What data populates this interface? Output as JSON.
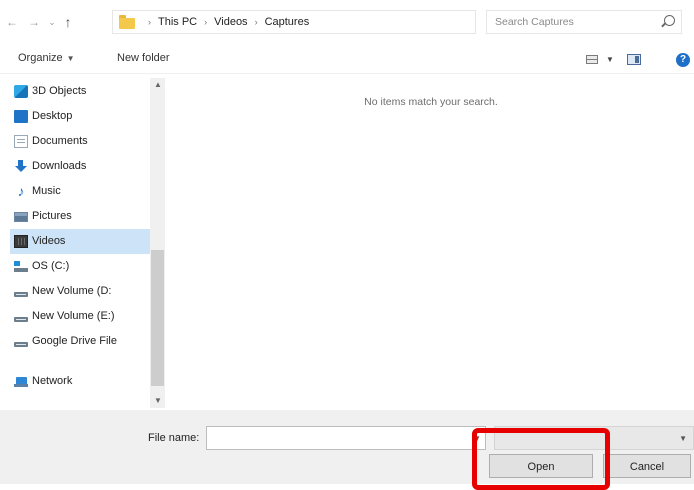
{
  "navigation": {
    "back_icon": "arrow-left-icon",
    "forward_icon": "arrow-right-icon",
    "recent_icon": "chevron-down-icon",
    "up_icon": "arrow-up-icon"
  },
  "address_bar": {
    "folder_icon": "folder-icon",
    "crumbs": [
      "This PC",
      "Videos",
      "Captures"
    ],
    "separator": "›"
  },
  "search": {
    "placeholder": "Search Captures",
    "value": ""
  },
  "toolbar": {
    "organize_label": "Organize",
    "new_folder_label": "New folder"
  },
  "sidebar": {
    "items": [
      {
        "label": "3D Objects",
        "icon": "3d-objects-icon",
        "selected": false
      },
      {
        "label": "Desktop",
        "icon": "desktop-icon",
        "selected": false
      },
      {
        "label": "Documents",
        "icon": "documents-icon",
        "selected": false
      },
      {
        "label": "Downloads",
        "icon": "downloads-icon",
        "selected": false
      },
      {
        "label": "Music",
        "icon": "music-icon",
        "selected": false
      },
      {
        "label": "Pictures",
        "icon": "pictures-icon",
        "selected": false
      },
      {
        "label": "Videos",
        "icon": "videos-icon",
        "selected": true
      },
      {
        "label": "OS (C:)",
        "icon": "drive-icon",
        "selected": false
      },
      {
        "label": "New Volume (D:",
        "icon": "drive-icon",
        "selected": false
      },
      {
        "label": "New Volume (E:)",
        "icon": "drive-icon",
        "selected": false
      },
      {
        "label": "Google Drive File",
        "icon": "drive-icon",
        "selected": false
      },
      {
        "label": "Network",
        "icon": "network-icon",
        "selected": false
      }
    ]
  },
  "content": {
    "empty_message": "No items match your search."
  },
  "footer": {
    "file_name_label": "File name:",
    "file_name_value": "",
    "file_type_value": "",
    "open_label": "Open",
    "cancel_label": "Cancel"
  },
  "colors": {
    "selection": "#cde3f7",
    "highlight": "#e60000",
    "accent": "#1e6fc8"
  }
}
